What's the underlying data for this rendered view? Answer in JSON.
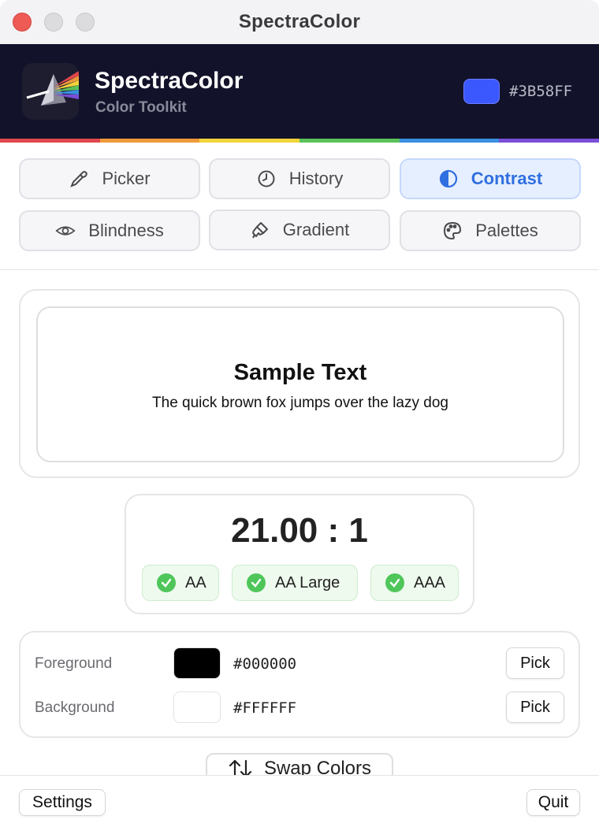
{
  "window": {
    "title": "SpectraColor"
  },
  "header": {
    "app_name": "SpectraColor",
    "subtitle": "Color Toolkit",
    "current_color_hex": "#3B58FF",
    "current_color": "#3B58FF"
  },
  "rainbow_colors": [
    "#e0474c",
    "#ef9a3a",
    "#f2d33a",
    "#5cc15a",
    "#3a8fe0",
    "#7a4fd6"
  ],
  "tabs": [
    {
      "label": "Picker",
      "icon": "eyedropper-icon",
      "active": false
    },
    {
      "label": "History",
      "icon": "clock-icon",
      "active": false
    },
    {
      "label": "Contrast",
      "icon": "contrast-icon",
      "active": true
    },
    {
      "label": "Blindness",
      "icon": "eye-icon",
      "active": false
    },
    {
      "label": "Gradient",
      "icon": "paintbrush-icon",
      "active": false
    },
    {
      "label": "Palettes",
      "icon": "palette-icon",
      "active": false
    }
  ],
  "preview": {
    "title": "Sample Text",
    "body": "The quick brown fox jumps over the lazy dog"
  },
  "contrast": {
    "ratio": "21.00 : 1",
    "badges": [
      {
        "label": "AA",
        "pass": true
      },
      {
        "label": "AA Large",
        "pass": true
      },
      {
        "label": "AAA",
        "pass": true
      }
    ]
  },
  "colors": {
    "foreground": {
      "label": "Foreground",
      "hex": "#000000",
      "pick_label": "Pick"
    },
    "background": {
      "label": "Background",
      "hex": "#FFFFFF",
      "pick_label": "Pick"
    }
  },
  "swap": {
    "label": "Swap Colors"
  },
  "footer": {
    "settings_label": "Settings",
    "quit_label": "Quit"
  }
}
